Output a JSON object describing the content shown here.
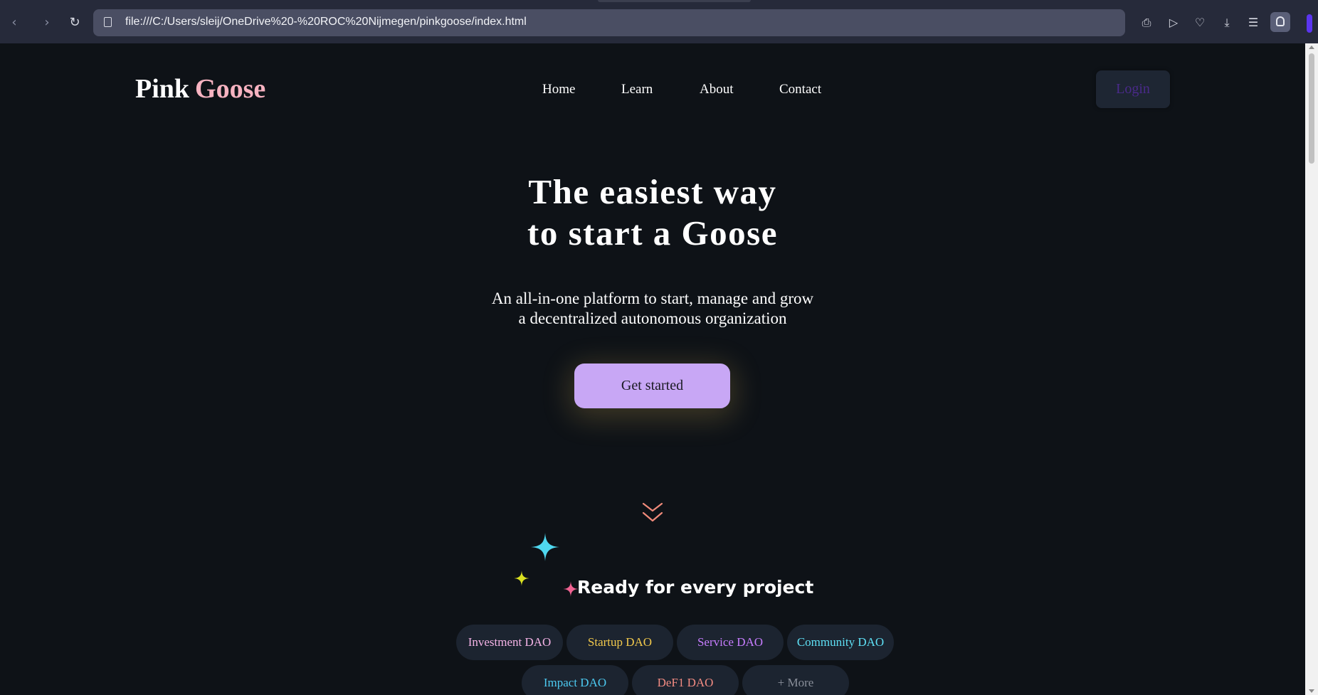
{
  "browser": {
    "url": "file:///C:/Users/sleij/OneDrive%20-%20ROC%20Nijmegen/pinkgoose/index.html",
    "icons": [
      "back-icon",
      "forward-icon",
      "reload-icon",
      "page-icon",
      "camera-icon",
      "send-icon",
      "heart-icon",
      "download-icon",
      "menu-icon",
      "profile-icon"
    ]
  },
  "site": {
    "logo": {
      "first": "Pink",
      "second": "Goose"
    },
    "nav": [
      "Home",
      "Learn",
      "About",
      "Contact"
    ],
    "login_label": "Login",
    "hero": {
      "title_line1": "The easiest way",
      "title_line2": "to start a Goose",
      "sub_line1": "An all-in-one platform to start, manage and grow",
      "sub_line2": "a decentralized autonomous organization",
      "cta_label": "Get started"
    },
    "section_title": "Ready for every project",
    "chips": [
      {
        "label": "Investment DAO",
        "color": "#f4b3e6"
      },
      {
        "label": "Startup DAO",
        "color": "#f2c94c"
      },
      {
        "label": "Service DAO",
        "color": "#c77dff"
      },
      {
        "label": "Community DAO",
        "color": "#5ee0f5"
      },
      {
        "label": "Impact DAO",
        "color": "#4cc9f0"
      },
      {
        "label": "DeF1 DAO",
        "color": "#f28b82"
      },
      {
        "label": "+ More",
        "color": "#8a8f9a"
      }
    ]
  },
  "colors": {
    "background": "#0e1217",
    "logo_accent": "#f7b3c1",
    "cta": "#c8a7f5",
    "sparkle_cyan": "#4fd8f0",
    "sparkle_yellow": "#d9e021",
    "sparkle_pink": "#f06292",
    "chevron": "#f08a7a"
  }
}
